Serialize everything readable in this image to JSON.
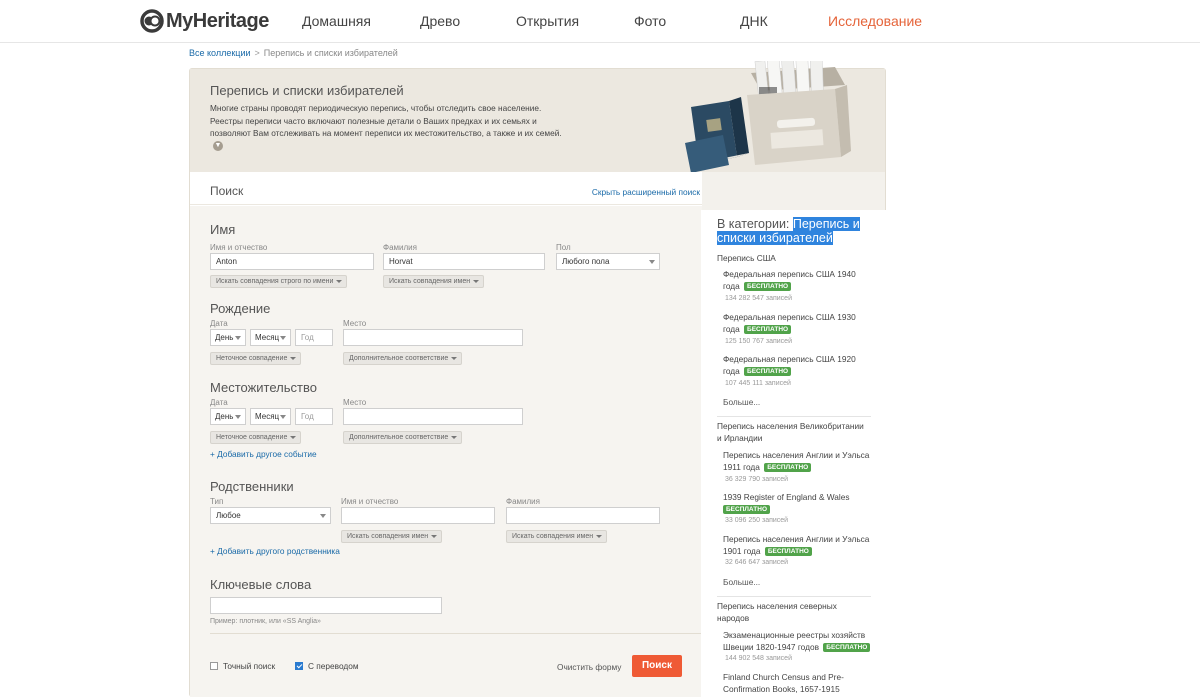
{
  "header": {
    "logo_text": "MyHeritage",
    "nav": [
      "Домашняя",
      "Древо",
      "Открытия",
      "Фото",
      "ДНК",
      "Исследование"
    ],
    "active_index": 5
  },
  "breadcrumb": {
    "root": "Все коллекции",
    "separator": ">",
    "current": "Перепись и списки избирателей"
  },
  "intro": {
    "title": "Перепись и списки избирателей",
    "lines": [
      "Многие страны проводят периодическую перепись, чтобы отследить свое население.",
      "Реестры переписи часто включают полезные детали о Ваших предках и их семьях и",
      "позволяют Вам отслеживать на момент переписи их местожительство, а также и их семей."
    ]
  },
  "search": {
    "title": "Поиск",
    "advanced_link": "Скрыть расширенный поиск",
    "name": {
      "section": "Имя",
      "first_label": "Имя и отчество",
      "first_value": "Anton",
      "last_label": "Фамилия",
      "last_value": "Horvat",
      "gender_label": "Пол",
      "gender_value": "Любого пола",
      "first_match": "Искать совпадения строго по имени",
      "last_match": "Искать совпадения имен"
    },
    "birth": {
      "section": "Рождение",
      "date_label": "Дата",
      "day": "День",
      "month": "Месяц",
      "year_placeholder": "Год",
      "date_match": "Неточное совпадение",
      "place_label": "Место",
      "place_match": "Дополнительное соответствие"
    },
    "residence": {
      "section": "Местожительство",
      "date_label": "Дата",
      "day": "День",
      "month": "Месяц",
      "year_placeholder": "Год",
      "date_match": "Неточное совпадение",
      "place_label": "Место",
      "place_match": "Дополнительное соответствие",
      "add_event": "+ Добавить другое событие"
    },
    "relatives": {
      "section": "Родственники",
      "type_label": "Тип",
      "type_value": "Любое",
      "first_label": "Имя и отчество",
      "last_label": "Фамилия",
      "first_match": "Искать совпадения имен",
      "last_match": "Искать совпадения имен",
      "add_relative": "+ Добавить другого родственника"
    },
    "keywords": {
      "section": "Ключевые слова",
      "hint": "Пример: плотник, или «SS Anglia»"
    },
    "footer": {
      "exact_label": "Точный поиск",
      "exact_checked": false,
      "translate_label": "С переводом",
      "translate_checked": true,
      "clear": "Очистить форму",
      "submit": "Поиск"
    }
  },
  "sidebar": {
    "prefix": "В категории: ",
    "highlight_line1": "Перепись и",
    "highlight_line2": "списки избирателей",
    "free": "БЕСПЛАТНО",
    "more": "Больше...",
    "groups": [
      {
        "title": "Перепись США",
        "items": [
          {
            "line1": "Федеральная перепись США 1940",
            "line2": "года",
            "count": "134 282 547 записей"
          },
          {
            "line1": "Федеральная перепись США 1930",
            "line2": "года",
            "count": "125 150 767 записей"
          },
          {
            "line1": "Федеральная перепись США 1920",
            "line2": "года",
            "count": "107 445 111 записей"
          }
        ]
      },
      {
        "title_line1": "Перепись населения Великобритании",
        "title_line2": "и Ирландии",
        "items": [
          {
            "line1": "Перепись населения Англии и Уэльса",
            "line2": "1911 года",
            "count": "36 329 790 записей"
          },
          {
            "line1": "1939 Register of England & Wales",
            "line2": "",
            "count": "33 096 250 записей"
          },
          {
            "line1": "Перепись населения Англии и Уэльса",
            "line2": "1901 года",
            "count": "32 646 647 записей"
          }
        ]
      },
      {
        "title_line1": "Перепись населения северных",
        "title_line2": "народов",
        "items": [
          {
            "line1": "Экзаменационные реестры хозяйств",
            "line2": "Швеции 1820-1947 годов",
            "count": "144 902 548 записей"
          },
          {
            "line1": "Finland Church Census and Pre-",
            "line2": "Confirmation Books, 1657-1915",
            "count": ""
          }
        ]
      }
    ]
  }
}
